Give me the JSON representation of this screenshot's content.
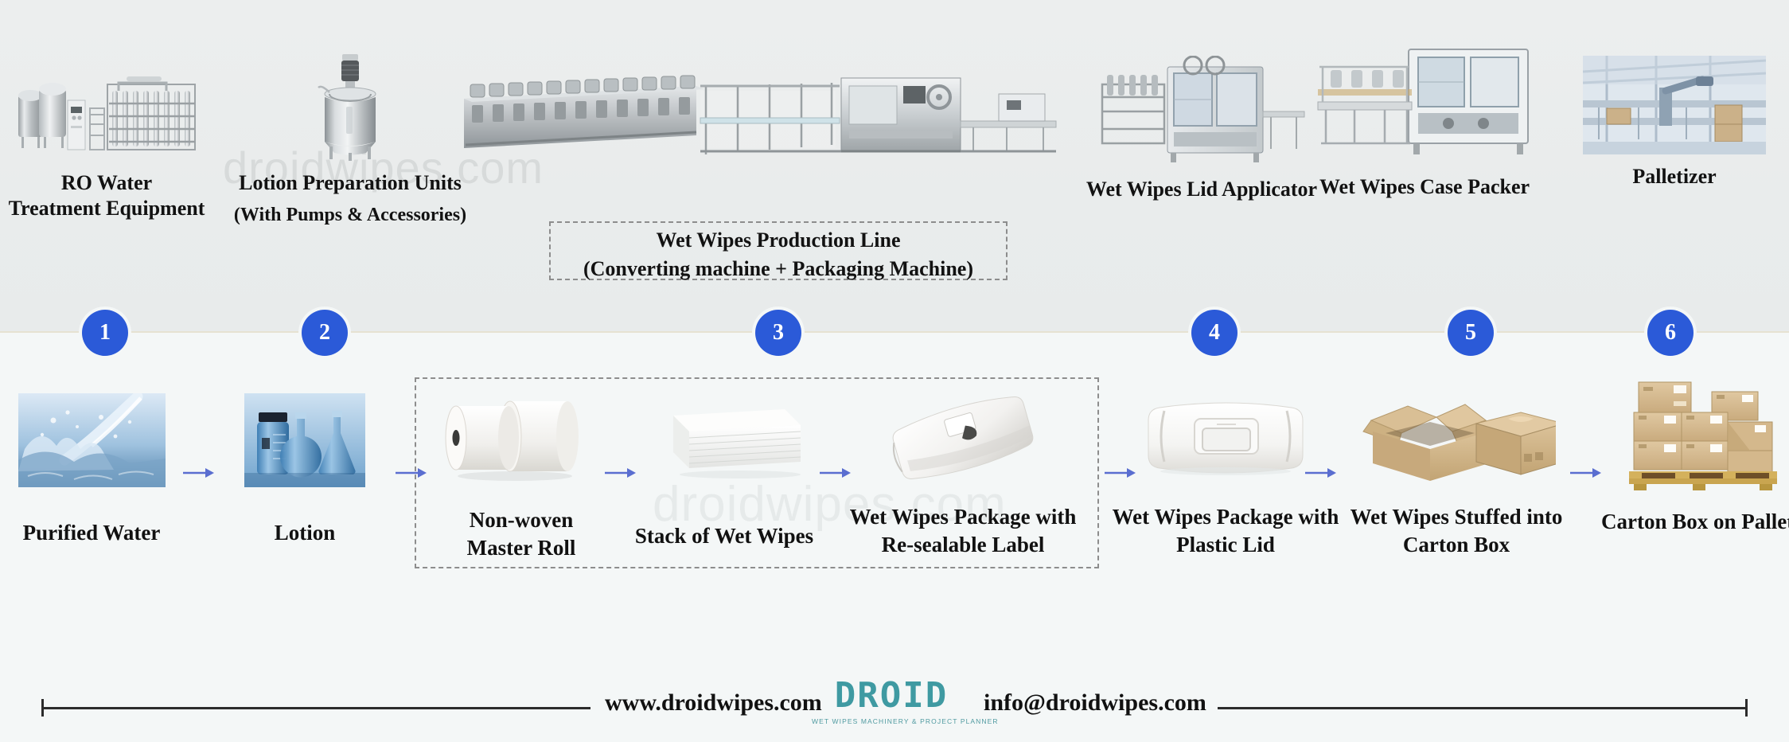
{
  "watermark": {
    "top": "droidwipes.com",
    "bottom": "droidwipes.com"
  },
  "colors": {
    "step_circle": "#2b5ad8",
    "arrow": "#4a5fd0",
    "logo_teal": "#3f9aa2",
    "top_band_bg": "#eceeee",
    "bottom_band_bg": "#f4f7f7",
    "divider": "#e6e2d2"
  },
  "machines": [
    {
      "id": 1,
      "line1": "RO Water",
      "line2": "Treatment Equipment",
      "icon": "ro-water-treatment-equipment-image"
    },
    {
      "id": 2,
      "line1": "Lotion Preparation Units",
      "line2": "(With Pumps & Accessories)",
      "icon": "lotion-preparation-tank-image"
    },
    {
      "id": 3,
      "line1": "Wet Wipes Production Line",
      "line2": "(Converting machine + Packaging Machine)",
      "icon": "wet-wipes-production-line-image",
      "boxed": true
    },
    {
      "id": 4,
      "line1": "Wet Wipes Lid Applicator",
      "line2": "",
      "icon": "wet-wipes-lid-applicator-image"
    },
    {
      "id": 5,
      "line1": "Wet Wipes Case Packer",
      "line2": "",
      "icon": "wet-wipes-case-packer-image"
    },
    {
      "id": 6,
      "line1": "Palletizer",
      "line2": "",
      "icon": "palletizer-image"
    }
  ],
  "steps": [
    "1",
    "2",
    "3",
    "4",
    "5",
    "6"
  ],
  "products": [
    {
      "line1": "Purified Water",
      "line2": "",
      "icon": "purified-water-splash-image"
    },
    {
      "line1": "Lotion",
      "line2": "",
      "icon": "lotion-bottles-image"
    },
    {
      "line1": "Non-woven",
      "line2": "Master Roll",
      "icon": "nonwoven-master-roll-image"
    },
    {
      "line1": "Stack of Wet Wipes",
      "line2": "",
      "icon": "stack-of-wet-wipes-image"
    },
    {
      "line1": "Wet Wipes Package with",
      "line2": "Re-sealable Label",
      "icon": "wet-wipes-package-resealable-label-image"
    },
    {
      "line1": "Wet Wipes Package with",
      "line2": "Plastic Lid",
      "icon": "wet-wipes-package-plastic-lid-image"
    },
    {
      "line1": "Wet Wipes Stuffed into",
      "line2": "Carton Box",
      "icon": "wet-wipes-carton-box-image"
    },
    {
      "line1": "Carton Box on Pallet",
      "line2": "",
      "icon": "carton-box-on-pallet-image"
    }
  ],
  "footer": {
    "website": "www.droidwipes.com",
    "email": "info@droidwipes.com",
    "logo_word": "DROID",
    "logo_tagline": "WET WIPES MACHINERY & PROJECT PLANNER"
  }
}
